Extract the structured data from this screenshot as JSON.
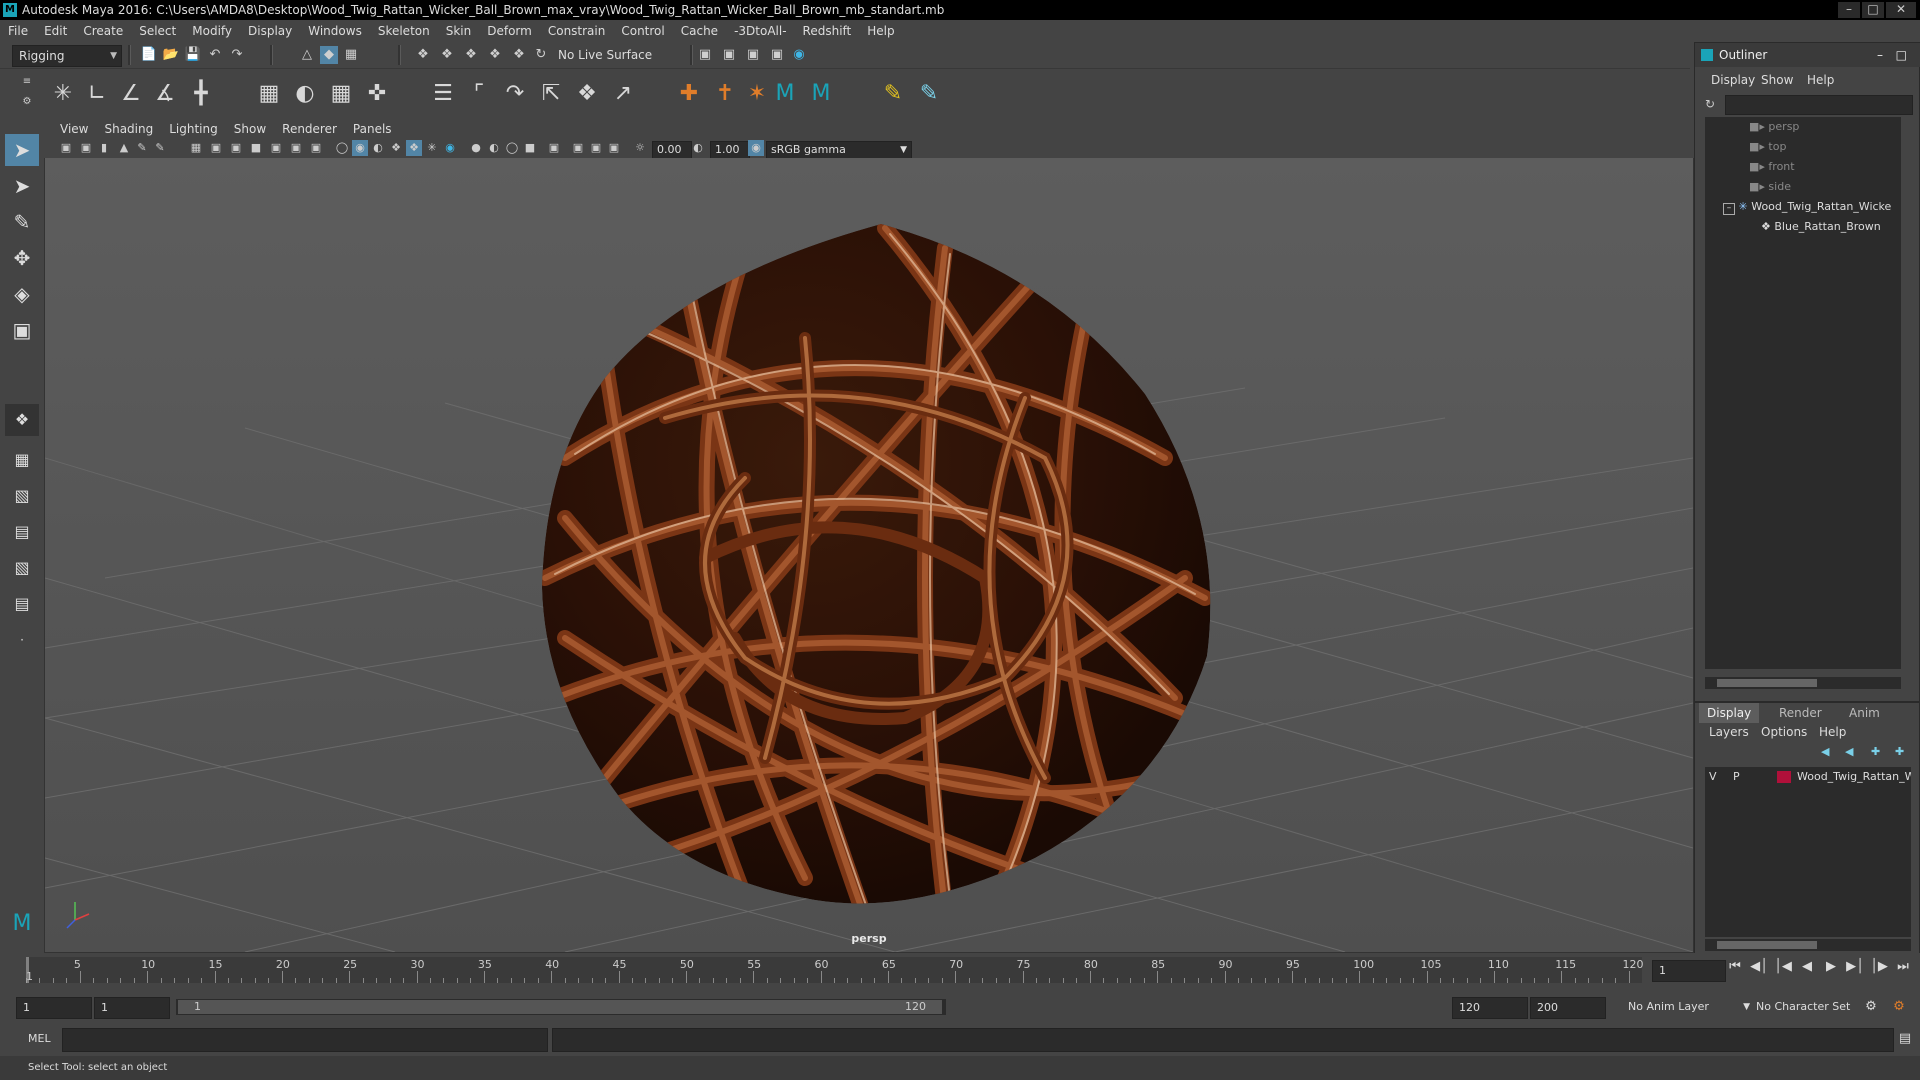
{
  "window": {
    "title": "Autodesk Maya 2016: C:\\Users\\AMDA8\\Desktop\\Wood_Twig_Rattan_Wicker_Ball_Brown_max_vray\\Wood_Twig_Rattan_Wicker_Ball_Brown_mb_standart.mb"
  },
  "menubar": [
    "File",
    "Edit",
    "Create",
    "Select",
    "Modify",
    "Display",
    "Windows",
    "Skeleton",
    "Skin",
    "Deform",
    "Constrain",
    "Control",
    "Cache",
    "-3DtoAll-",
    "Redshift",
    "Help"
  ],
  "status_line": {
    "mode": "Rigging",
    "live_surface": "No Live Surface"
  },
  "viewport": {
    "menus": [
      "View",
      "Shading",
      "Lighting",
      "Show",
      "Renderer",
      "Panels"
    ],
    "exposure": "0.00",
    "gamma": "1.00",
    "color_space": "sRGB gamma",
    "camera_label": "persp"
  },
  "outliner": {
    "title": "Outliner",
    "menus": [
      "Display",
      "Show",
      "Help"
    ],
    "items": [
      {
        "label": "persp",
        "type": "camera"
      },
      {
        "label": "top",
        "type": "camera"
      },
      {
        "label": "front",
        "type": "camera"
      },
      {
        "label": "side",
        "type": "camera"
      },
      {
        "label": "Wood_Twig_Rattan_Wicke",
        "type": "group"
      },
      {
        "label": "Blue_Rattan_Brown",
        "type": "mesh"
      }
    ]
  },
  "layer_editor": {
    "tabs": [
      "Display",
      "Render",
      "Anim"
    ],
    "menus": [
      "Layers",
      "Options",
      "Help"
    ],
    "layers": [
      {
        "v": "V",
        "p": "P",
        "name": "Wood_Twig_Rattan_W",
        "color": "#b0103a"
      }
    ]
  },
  "timeline": {
    "ticks": [
      "5",
      "10",
      "15",
      "20",
      "25",
      "30",
      "35",
      "40",
      "45",
      "50",
      "55",
      "60",
      "65",
      "70",
      "75",
      "80",
      "85",
      "90",
      "95",
      "100",
      "105",
      "110",
      "115",
      "120"
    ],
    "start_marker": "1",
    "current_frame": "1"
  },
  "range": {
    "start": "1",
    "playback_start": "1",
    "slider_start": "1",
    "slider_end": "120",
    "playback_end": "120",
    "end": "200",
    "anim_layer": "No Anim Layer",
    "character_set": "No Character Set"
  },
  "command_line": {
    "language": "MEL"
  },
  "help_line": "Select Tool: select an object",
  "colors": {
    "accent": "#5285a6",
    "rattan": "#8a4020"
  }
}
